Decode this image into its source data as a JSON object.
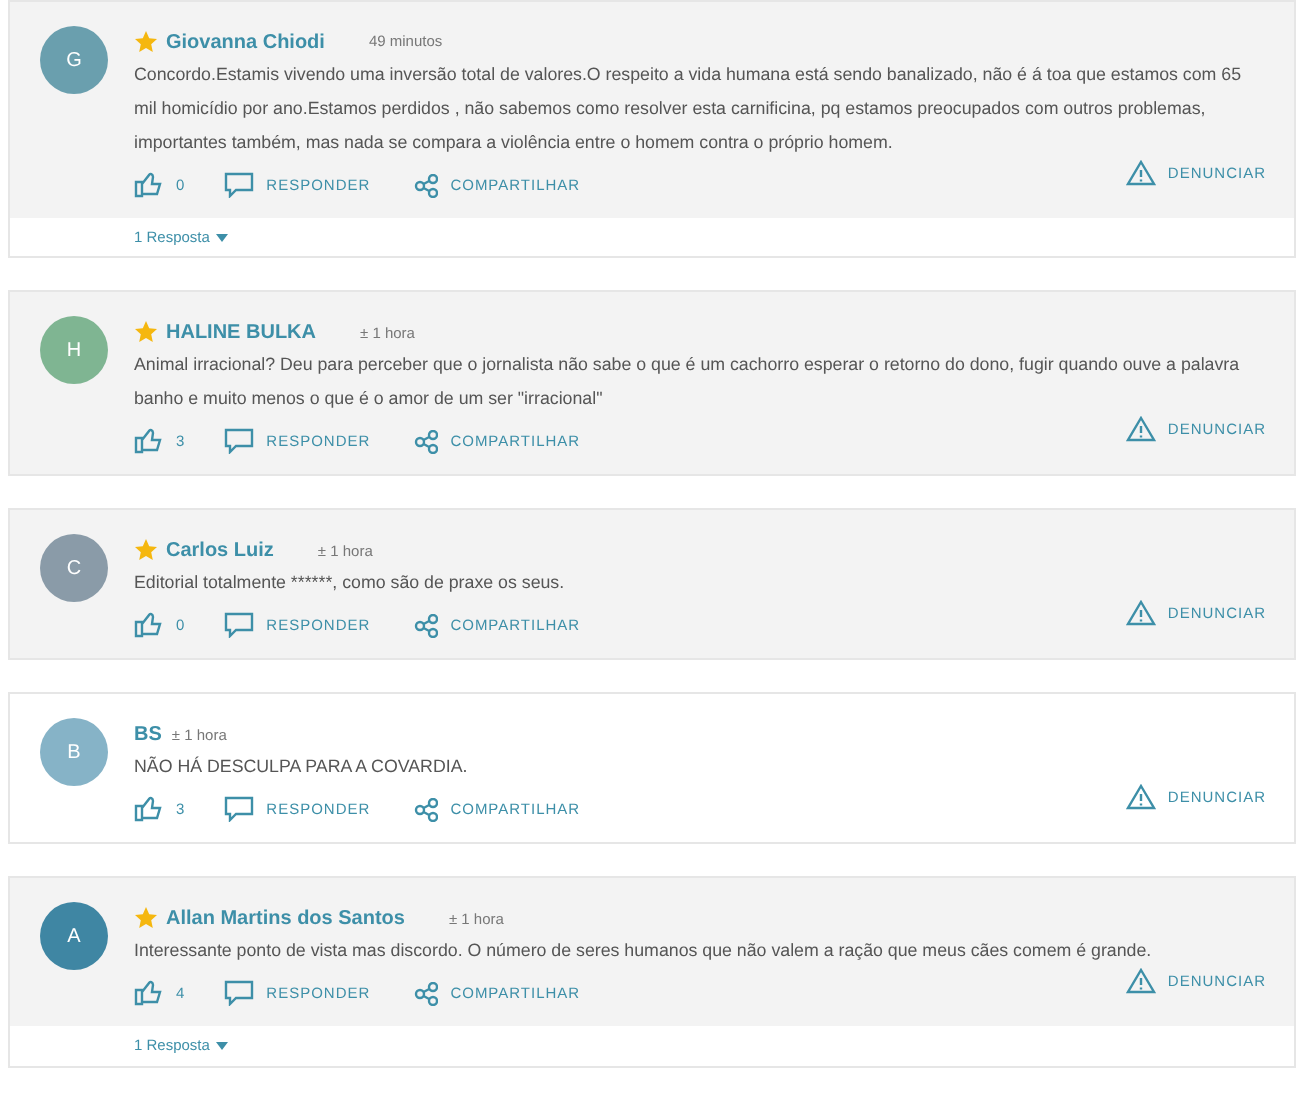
{
  "comments": [
    {
      "initial": "G",
      "color": "#6a9fae",
      "featured": true,
      "author": "Giovanna Chiodi",
      "time": "49 minutos",
      "text": "Concordo.Estamis vivendo uma inversão total de valores.O respeito a vida humana está sendo banalizado, não é á toa que estamos com 65 mil homicídio por ano.Estamos perdidos , não sabemos como resolver esta carnificina, pq estamos preocupados com outros problemas, importantes também, mas nada se compara a violência entre o homem contra o próprio homem.",
      "likes": "0",
      "reply": "RESPONDER",
      "share": "COMPARTILHAR",
      "report": "DENUNCIAR",
      "replies": "1 Resposta"
    },
    {
      "initial": "H",
      "color": "#7fb592",
      "featured": true,
      "author": "HALINE BULKA",
      "time": "± 1 hora",
      "text": "Animal irracional? Deu para perceber que o jornalista não sabe o que é um cachorro esperar o retorno do dono, fugir quando ouve a palavra banho e muito menos o que é o amor de um ser \"irracional\"",
      "likes": "3",
      "reply": "RESPONDER",
      "share": "COMPARTILHAR",
      "report": "DENUNCIAR"
    },
    {
      "initial": "C",
      "color": "#8a9ba8",
      "featured": true,
      "author": "Carlos Luiz",
      "time": "± 1 hora",
      "text": "Editorial totalmente ******, como são de praxe os seus.",
      "likes": "0",
      "reply": "RESPONDER",
      "share": "COMPARTILHAR",
      "report": "DENUNCIAR"
    },
    {
      "initial": "B",
      "color": "#86b3c7",
      "featured": false,
      "author": "BS",
      "time": "± 1 hora",
      "text": "NÃO HÁ DESCULPA PARA A COVARDIA.",
      "likes": "3",
      "reply": "RESPONDER",
      "share": "COMPARTILHAR",
      "report": "DENUNCIAR"
    },
    {
      "initial": "A",
      "color": "#3f86a3",
      "featured": true,
      "author": "Allan Martins dos Santos",
      "time": "± 1 hora",
      "text": "Interessante ponto de vista mas discordo. O número de seres humanos que não valem a ração que meus cães comem é grande.",
      "likes": "4",
      "reply": "RESPONDER",
      "share": "COMPARTILHAR",
      "report": "DENUNCIAR",
      "replies": "1 Resposta"
    }
  ]
}
